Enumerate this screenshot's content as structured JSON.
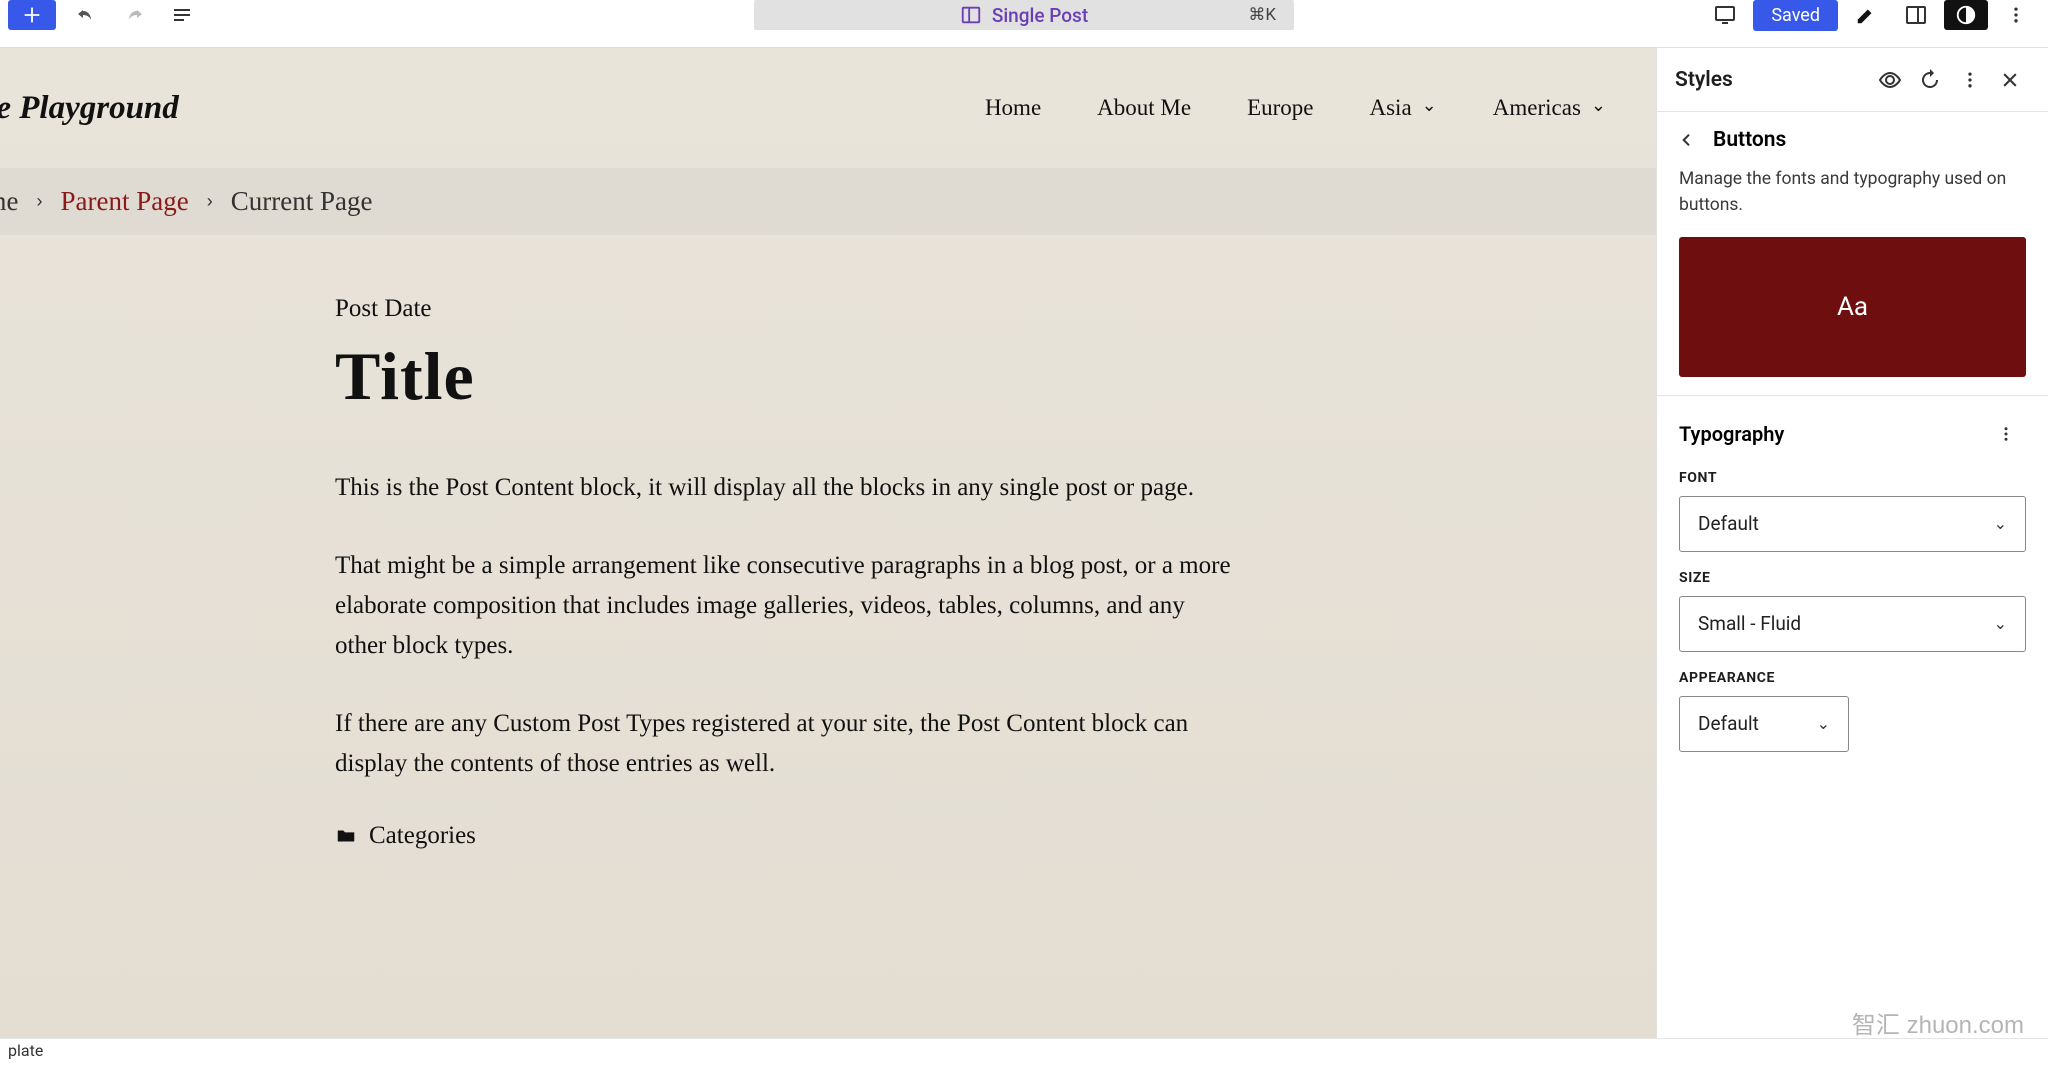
{
  "toolbar": {
    "template_label": "Single Post",
    "shortcut": "⌘K",
    "saved_label": "Saved"
  },
  "site": {
    "title": "he Playground",
    "nav": [
      "Home",
      "About Me",
      "Europe",
      "Asia",
      "Americas"
    ]
  },
  "breadcrumbs": {
    "items": [
      "ome",
      "Parent Page",
      "Current Page"
    ]
  },
  "post": {
    "date_label": "Post Date",
    "title": "Title",
    "para1": "This is the Post Content block, it will display all the blocks in any single post or page.",
    "para2": "That might be a simple arrangement like consecutive paragraphs in a blog post, or a more elaborate composition that includes image galleries, videos, tables, columns, and any other block types.",
    "para3": "If there are any Custom Post Types registered at your site, the Post Content block can display the contents of those entries as well.",
    "categories_label": "Categories"
  },
  "sidebar": {
    "title": "Styles",
    "back_label": "Buttons",
    "description": "Manage the fonts and typography used on buttons.",
    "preview_text": "Aa",
    "preview_bg": "#6e0e0e",
    "section_title": "Typography",
    "font_label": "FONT",
    "font_value": "Default",
    "size_label": "SIZE",
    "size_value": "Small - Fluid",
    "appearance_label": "APPEARANCE",
    "appearance_value": "Default"
  },
  "footer": {
    "text": "plate"
  },
  "watermark": {
    "brand": "智汇",
    "domain": "zhuon.com"
  }
}
